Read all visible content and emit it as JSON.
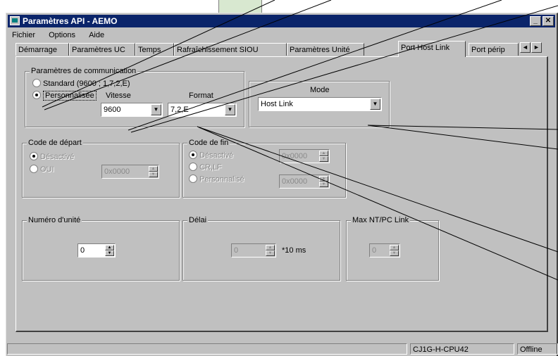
{
  "window": {
    "title": "Paramètres API - AEMO",
    "minimize_label": "_",
    "close_label": "✕"
  },
  "menu": [
    "Fichier",
    "Options",
    "Aide"
  ],
  "tabs": [
    {
      "label": "Démarrage",
      "active": false
    },
    {
      "label": "Paramètres UC",
      "active": false
    },
    {
      "label": "Temps",
      "active": false
    },
    {
      "label": "Rafraîchissement SIOU",
      "active": false
    },
    {
      "label": "Paramètres Unité",
      "active": false
    },
    {
      "label": "Port Host Link",
      "active": true
    },
    {
      "label": "Port périp",
      "active": false
    }
  ],
  "tab_scroll": {
    "left": "◄",
    "right": "►"
  },
  "comm": {
    "group_label": "Paramètres de communication",
    "standard_label": "Standard (9600 ; 1,7,2,E)",
    "custom_label": "Personnalisée",
    "selected": "custom",
    "speed_label": "Vitesse",
    "speed_value": "9600",
    "format_label": "Format",
    "format_value": "7,2,E"
  },
  "mode": {
    "label": "Mode",
    "value": "Host Link"
  },
  "start_code": {
    "group_label": "Code de départ",
    "option1": "Désactivé",
    "option2": "OUI",
    "value": "0x0000"
  },
  "end_code": {
    "group_label": "Code de fin",
    "option1": "Désactivé",
    "option2": "CR,LF",
    "option3": "Personnalisé",
    "value1": "0x0000",
    "value2": "0x0000"
  },
  "unit_number": {
    "group_label": "Numéro d'unité",
    "value": "0"
  },
  "delay": {
    "group_label": "Délai",
    "value": "0",
    "unit": "*10 ms"
  },
  "max_nt": {
    "group_label": "Max NT/PC Link",
    "value": "0"
  },
  "status": {
    "cpu": "CJ1G-H-CPU42",
    "mode": "Offline"
  },
  "spin_glyphs": {
    "up": "▲",
    "down": "▼",
    "dropdown": "▼"
  }
}
